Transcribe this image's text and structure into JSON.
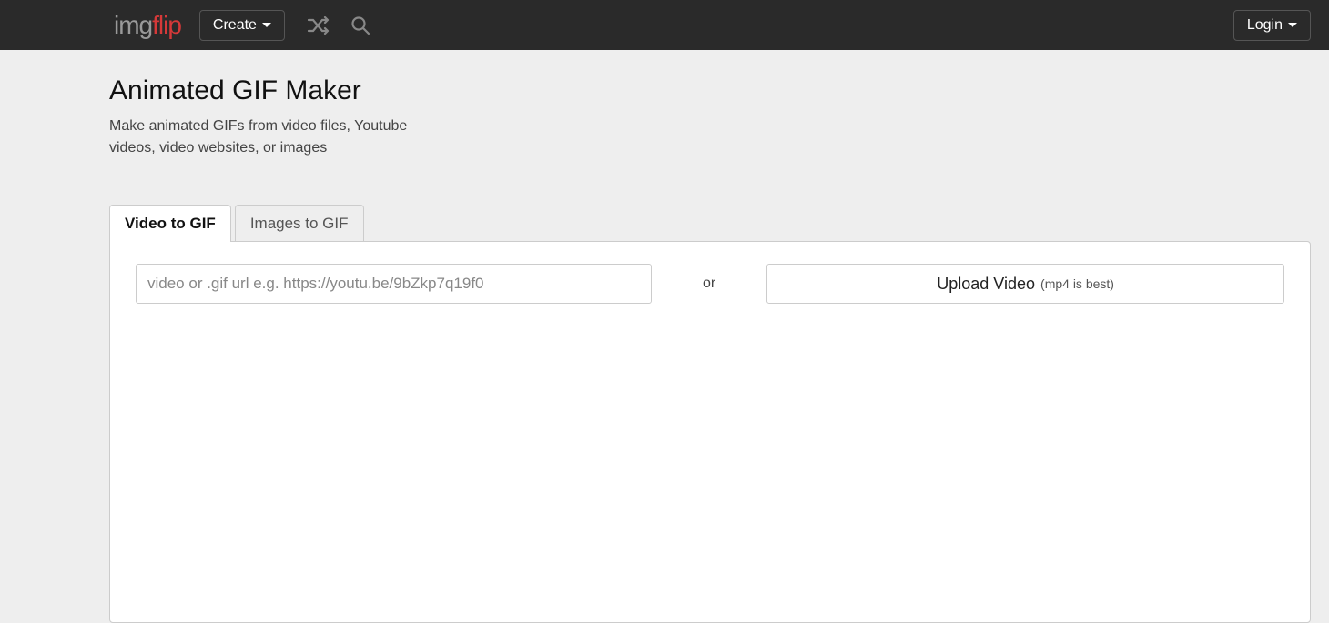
{
  "header": {
    "logo_img": "img",
    "logo_flip": "flip",
    "create_label": "Create",
    "login_label": "Login"
  },
  "page": {
    "title": "Animated GIF Maker",
    "subtitle": "Make animated GIFs from video files, Youtube videos, video websites, or images"
  },
  "tabs": {
    "video_to_gif": "Video to GIF",
    "images_to_gif": "Images to GIF"
  },
  "panel": {
    "url_placeholder": "video or .gif url e.g. https://youtu.be/9bZkp7q19f0",
    "or_text": "or",
    "upload_label": "Upload Video",
    "upload_hint": "(mp4 is best)"
  }
}
